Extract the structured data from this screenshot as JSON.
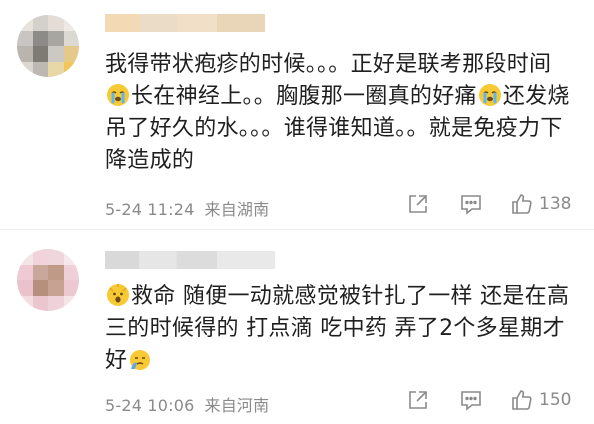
{
  "comments": [
    {
      "text_parts": [
        "我得带状疱疹的时候。。。正好是联考那段时间",
        "长在神经上。。胸腹那一圈真的好痛",
        "还发烧吊了好久的水。。。谁得谁知道。。就是免疫力下降造成的"
      ],
      "emojis": [
        "crying-face-emoji",
        "crying-face-emoji"
      ],
      "timestamp": "5-24 11:24",
      "location": "来自湖南",
      "likes": "138"
    },
    {
      "text_parts": [
        "救命  随便一动就感觉被针扎了一样  还是在高三的时候得的  打点滴  吃中药  弄了2个多星期才好"
      ],
      "emojis": [
        "mind-blown-emoji",
        "sad-face-emoji"
      ],
      "timestamp": "5-24 10:06",
      "location": "来自河南",
      "likes": "150"
    }
  ],
  "colors": {
    "meta": "#8a8a8a",
    "text": "#1f1f1f",
    "divider": "#ececec"
  }
}
